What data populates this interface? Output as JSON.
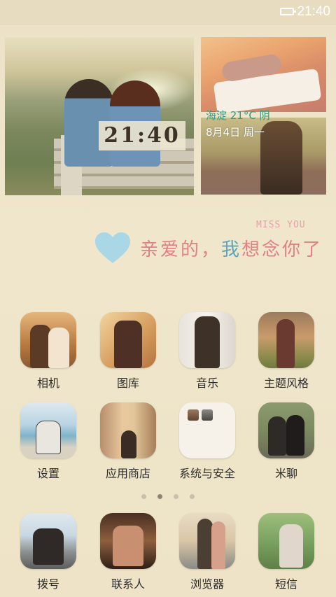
{
  "status_bar": {
    "time": "21:40",
    "icons": [
      "battery-icon"
    ]
  },
  "widgets": {
    "clock": "21:40",
    "weather": "海淀 21°C 阴",
    "date": "8月4日 周一"
  },
  "banner": {
    "text_main": "亲爱的，",
    "text_accent": "我",
    "text_end": "想念你了",
    "miss_you": "MISS YOU"
  },
  "apps": [
    {
      "id": "camera",
      "label": "相机"
    },
    {
      "id": "gallery",
      "label": "图库"
    },
    {
      "id": "music",
      "label": "音乐"
    },
    {
      "id": "themes",
      "label": "主题风格"
    },
    {
      "id": "settings",
      "label": "设置"
    },
    {
      "id": "app-store",
      "label": "应用商店"
    },
    {
      "id": "system-security",
      "label": "系统与安全"
    },
    {
      "id": "mitalk",
      "label": "米聊"
    }
  ],
  "page_indicator": {
    "count": 4,
    "active_index": 1
  },
  "dock": [
    {
      "id": "phone",
      "label": "拨号"
    },
    {
      "id": "contacts",
      "label": "联系人"
    },
    {
      "id": "browser",
      "label": "浏览器"
    },
    {
      "id": "messages",
      "label": "短信"
    }
  ],
  "colors": {
    "background": "#eee3c6",
    "weather_text": "#2f9a82",
    "love_text": "#e07f86",
    "love_accent": "#5fa5b8",
    "heart": "#a9d7e6"
  }
}
